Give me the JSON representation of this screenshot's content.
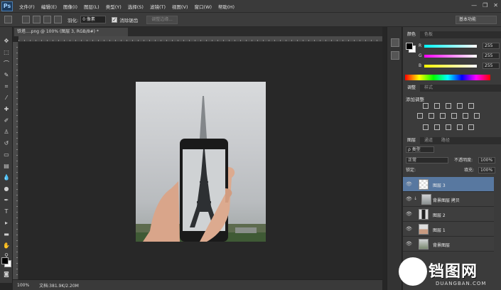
{
  "app": {
    "logo_text": "Ps"
  },
  "menu": [
    "文件(F)",
    "编辑(E)",
    "图像(I)",
    "图层(L)",
    "类型(Y)",
    "选择(S)",
    "滤镜(T)",
    "视图(V)",
    "窗口(W)",
    "帮助(H)"
  ],
  "window_controls": [
    "—",
    "❐",
    "✕"
  ],
  "options_bar": {
    "feather_label": "羽化:",
    "feather_value": "0 像素",
    "antialias_label": "消除锯齿",
    "refine_edge_button": "调整边缘...",
    "workspace": "基本功能"
  },
  "document": {
    "tab_label": "铁塔....png @ 100% (图层 3, RGB/8#) *",
    "zoom": "100%",
    "doc_info": "文档:381.9K/2.20M"
  },
  "color_panel": {
    "tabs": [
      "颜色",
      "色板"
    ],
    "channels": [
      {
        "label": "R",
        "value": "255"
      },
      {
        "label": "G",
        "value": "255"
      },
      {
        "label": "B",
        "value": "255"
      }
    ]
  },
  "adjustments_panel": {
    "tabs": [
      "调整",
      "样式"
    ],
    "title": "添加调整"
  },
  "layers_panel": {
    "tabs": [
      "图层",
      "通道",
      "路径"
    ],
    "filter_label": "ρ 类型",
    "blend_mode": "正常",
    "opacity_label": "不透明度:",
    "opacity_value": "100%",
    "lock_label": "锁定:",
    "fill_label": "填充:",
    "fill_value": "100%",
    "layers": [
      {
        "name": "图层 3",
        "selected": true
      },
      {
        "name": "背景图层 拷贝",
        "selected": false
      },
      {
        "name": "图层 2",
        "selected": false
      },
      {
        "name": "图层 1",
        "selected": false
      },
      {
        "name": "背景图层",
        "selected": false
      }
    ]
  },
  "watermark": {
    "main": "铛图网",
    "sub": "DUANGBAN.COM"
  },
  "colors": {
    "foreground": "#000000",
    "background": "#ffffff",
    "layer_selected": "#5878a0"
  }
}
